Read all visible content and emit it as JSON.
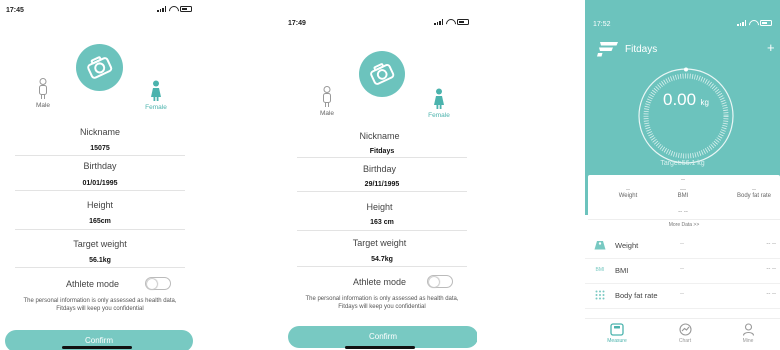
{
  "screen1": {
    "time": "17:45",
    "male_label": "Male",
    "female_label": "Female",
    "nickname_label": "Nickname",
    "nickname_value": "15075",
    "birthday_label": "Birthday",
    "birthday_value": "01/01/1995",
    "height_label": "Height",
    "height_value": "165cm",
    "target_label": "Target weight",
    "target_value": "56.1kg",
    "athlete_label": "Athlete mode",
    "note": "The personal information is only assessed as health data, Fitdays will keep you confidential",
    "confirm_label": "Confirm"
  },
  "screen2": {
    "time": "17:49",
    "male_label": "Male",
    "female_label": "Female",
    "nickname_label": "Nickname",
    "nickname_value": "Fitdays",
    "birthday_label": "Birthday",
    "birthday_value": "29/11/1995",
    "height_label": "Height",
    "height_value": "163 cm",
    "target_label": "Target weight",
    "target_value": "54.7kg",
    "athlete_label": "Athlete mode",
    "note": "The personal information is only assessed as health data, Fitdays will keep you confidential",
    "confirm_label": "Confirm"
  },
  "screen3": {
    "time": "17:52",
    "app_title": "Fitdays",
    "add_label": "+",
    "weight_value": "0.00",
    "weight_unit": "kg",
    "target_text": "Target:56.1 kg",
    "summary": {
      "top_dash": "--",
      "weight_dash": "--",
      "weight_label": "Weight",
      "bmi_dash": "---",
      "bmi_label": "BMI",
      "bodyfat_dash": "--",
      "bodyfat_label": "Body fat rate",
      "bottom_dash": "-- --",
      "more_label": "More Data >>"
    },
    "rows": [
      {
        "icon": "weight-icon",
        "label": "Weight",
        "mid": "--",
        "right": "-- --"
      },
      {
        "icon": "bmi-icon",
        "label": "BMI",
        "mid": "--",
        "right": "-- --"
      },
      {
        "icon": "bodyfat-icon",
        "label": "Body fat rate",
        "mid": "--",
        "right": "-- --"
      }
    ],
    "bmi_icon_text": "BMI",
    "tabs": {
      "measure": "Measure",
      "chart": "Chart",
      "mine": "Mine"
    }
  },
  "colors": {
    "accent": "#6cc3bd",
    "confirm": "#78c9c2"
  }
}
